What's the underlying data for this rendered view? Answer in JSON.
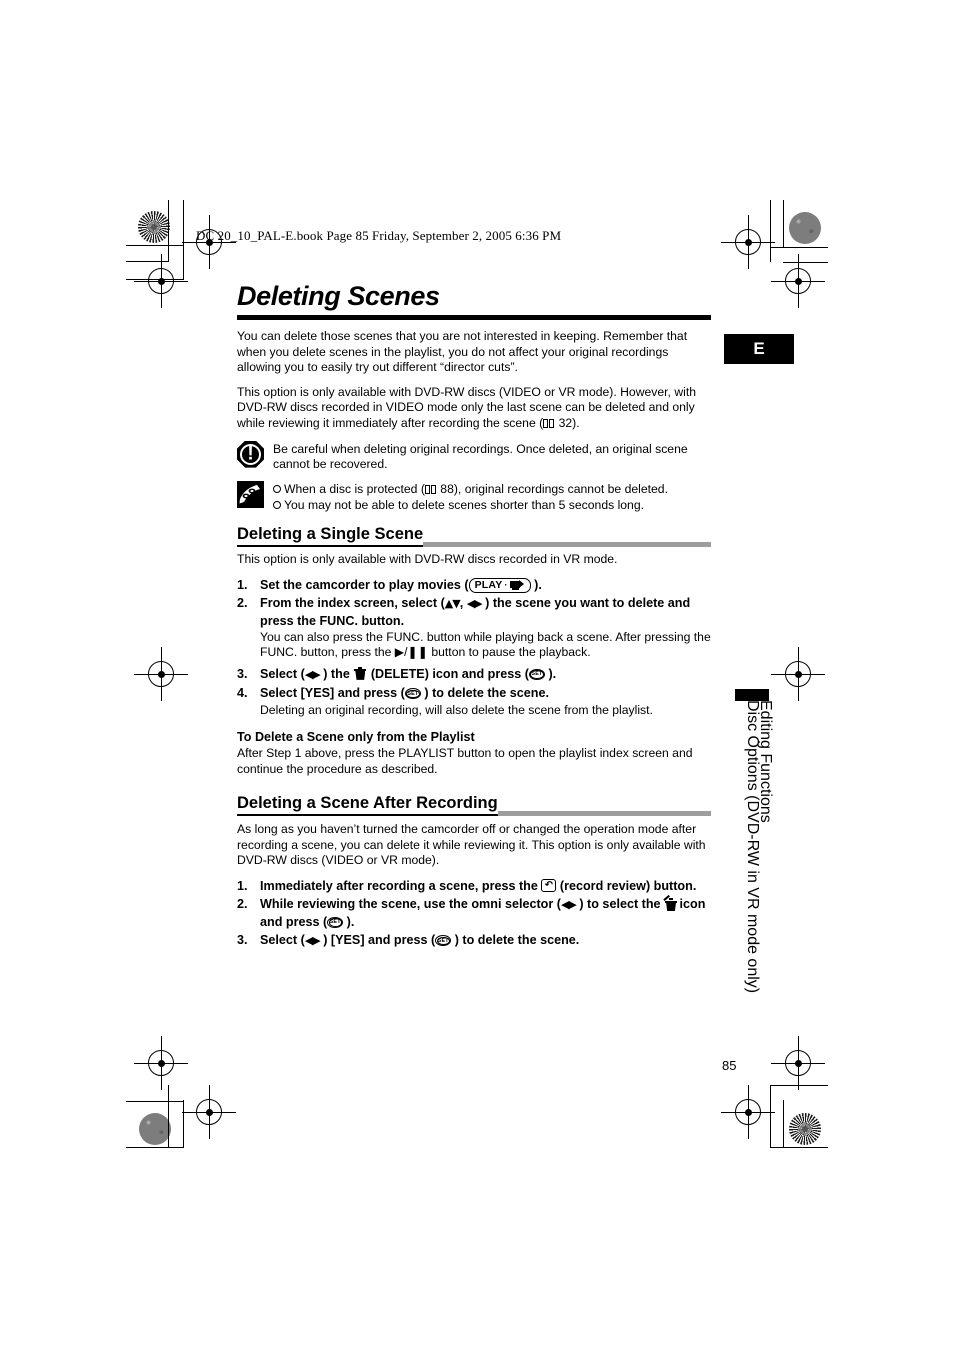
{
  "header": {
    "file_line": "DC 20_10_PAL-E.book  Page 85  Friday, September 2, 2005  6:36 PM"
  },
  "title": "Deleting Scenes",
  "intro": [
    "You can delete those scenes that you are not interested in keeping. Remember that when you delete scenes in the playlist, you do not affect your original recordings allowing you to easily try out different “director cuts”.",
    "This option is only available with DVD-RW discs (VIDEO or VR mode). However, with DVD-RW discs recorded in VIDEO mode only the last scene can be deleted and only while reviewing it immediately after recording the scene ("
  ],
  "intro2_tail": " 32).",
  "intro2_ref": "32",
  "callouts": {
    "warning": {
      "icon": "warning-exclamation-icon",
      "mark": "!",
      "text": "Be careful when deleting original recordings. Once deleted, an original scene cannot be recovered."
    },
    "note": {
      "icon": "note-memo-pencil-icon",
      "bullets": [
        {
          "pre": "When a disc is protected (",
          "ref": "88",
          "post": "), original recordings cannot be deleted."
        },
        {
          "pre": "You may not be able to delete scenes shorter than 5 seconds long.",
          "ref": "",
          "post": ""
        }
      ]
    }
  },
  "section1": {
    "heading": "Deleting a Single Scene",
    "lead": "This option is only available with DVD-RW discs recorded in VR mode.",
    "steps": [
      {
        "num": "1.",
        "pre": "Set the camcorder to play movies (",
        "badge": "PLAY",
        "post": " ).",
        "sub": ""
      },
      {
        "num": "2.",
        "pre": "From the index screen, select (",
        "arrows1": "▲▼",
        "mid": ", ",
        "arrows2": "◀▶",
        "post": " ) the scene you want to delete and press the FUNC. button.",
        "sub": "You can also press the FUNC. button while playing back a scene. After pressing the FUNC. button, press the ▶/❚❚ button to pause the playback."
      },
      {
        "num": "3.",
        "pre": "Select (",
        "arrows1": "◀▶",
        "post": " ) the ",
        "icon": "delete-trash-icon",
        "post2": " (DELETE) icon and press (",
        "set": "SET",
        "post3": " ).",
        "sub": ""
      },
      {
        "num": "4.",
        "pre": "Select [YES] and press (",
        "set": "SET",
        "post": " ) to delete the scene.",
        "sub": "Deleting an original recording, will also delete the scene from the playlist."
      }
    ],
    "playlist_head": "To Delete a Scene only from the Playlist",
    "playlist_body": "After Step 1 above, press the PLAYLIST button to open the playlist index screen and continue the procedure as described."
  },
  "section2": {
    "heading": "Deleting a Scene After Recording",
    "lead": "As long as you haven’t turned the camcorder off or changed the operation mode after recording a scene, you can delete it while reviewing it. This option is only available with DVD-RW discs (VIDEO or VR mode).",
    "steps": [
      {
        "num": "1.",
        "pre": "Immediately after recording a scene, press the ",
        "icon": "record-review-icon",
        "post": " (record review) button."
      },
      {
        "num": "2.",
        "pre": "While reviewing the scene, use the omni selector (",
        "arrows1": "◀▶",
        "post": " ) to select the ",
        "icon": "delete-trash-icon",
        "post2": " icon and press (",
        "set": "SET",
        "post3": " )."
      },
      {
        "num": "3.",
        "pre": "Select (",
        "arrows1": "◀▶",
        "post": " ) [YES] and press (",
        "set": "SET",
        "post2": " ) to delete the scene."
      }
    ]
  },
  "margin": {
    "language_tab": "E",
    "side_line1": "Editing Functions",
    "side_line2": "Disc Options (DVD-RW in VR mode only)",
    "page_number": "85"
  },
  "colors": {
    "rule_black": "#000000",
    "rule_gray": "#9d9d9d",
    "tab_black": "#000000"
  }
}
